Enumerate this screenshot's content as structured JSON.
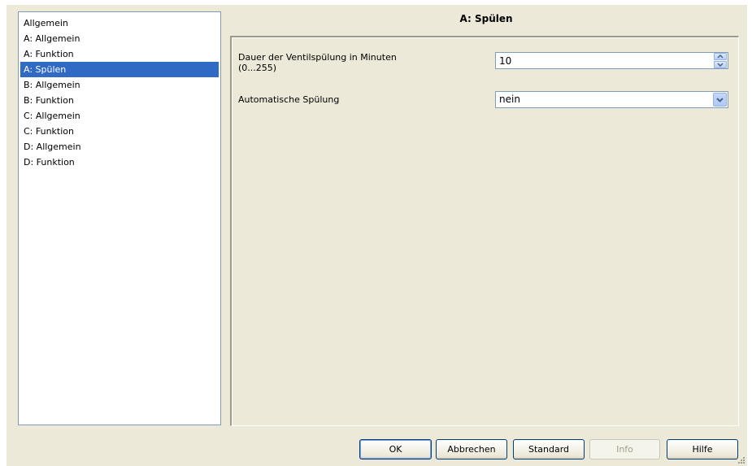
{
  "tree": {
    "items": [
      {
        "label": "Allgemein",
        "selected": false
      },
      {
        "label": "A: Allgemein",
        "selected": false
      },
      {
        "label": "A: Funktion",
        "selected": false
      },
      {
        "label": "A: Spülen",
        "selected": true
      },
      {
        "label": "B: Allgemein",
        "selected": false
      },
      {
        "label": "B: Funktion",
        "selected": false
      },
      {
        "label": "C: Allgemein",
        "selected": false
      },
      {
        "label": "C: Funktion",
        "selected": false
      },
      {
        "label": "D: Allgemein",
        "selected": false
      },
      {
        "label": "D: Funktion",
        "selected": false
      }
    ]
  },
  "page": {
    "title": "A: Spülen",
    "params": {
      "duration_label_line1": "Dauer der Ventilspülung in Minuten",
      "duration_label_line2": "(0...255)",
      "duration_value": "10",
      "auto_label": "Automatische Spülung",
      "auto_value": "nein"
    }
  },
  "buttons": {
    "ok": "OK",
    "cancel": "Abbrechen",
    "standard": "Standard",
    "info": "Info",
    "help": "Hilfe"
  },
  "icons": {
    "spin_up": "chevron-up-icon",
    "spin_down": "chevron-down-icon",
    "dropdown": "chevron-down-icon",
    "grip": "resize-grip-icon"
  },
  "colors": {
    "selection": "#316ac5",
    "dialog_bg": "#ece9d8",
    "input_border": "#7f9db9"
  }
}
